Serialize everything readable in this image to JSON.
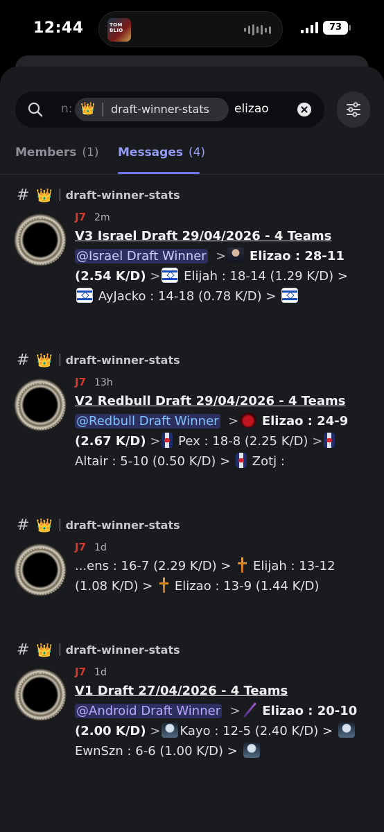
{
  "status_bar": {
    "time": "12:44",
    "island_art_text": "TOM BLIO",
    "battery": "73"
  },
  "search": {
    "prefix": "n:",
    "channel_chip": "draft-winner-stats",
    "query": "elizao"
  },
  "tabs": [
    {
      "label": "Members",
      "count": "(1)",
      "active": false
    },
    {
      "label": "Messages",
      "count": "(4)",
      "active": true
    }
  ],
  "colors": {
    "accent": "#949cf7",
    "author": "#d6392f",
    "mention_bg": "#3a3f73"
  },
  "results": [
    {
      "channel": "draft-winner-stats",
      "author": "J7",
      "timestamp": "2m",
      "title": "V3 Israel Draft 29/04/2026 - 4 Teams",
      "mention": "@Israel Draft Winner",
      "winner": "Elizao : 28-11 (2.54 K/D)",
      "rest1": "Elijah : 18-14 (1.29 K/D) >",
      "rest2": "AyJacko : 14-18 (0.78 K/D) >"
    },
    {
      "channel": "draft-winner-stats",
      "author": "J7",
      "timestamp": "13h",
      "title": "V2 Redbull Draft 29/04/2026 - 4 Teams",
      "mention": "@Redbull Draft Winner",
      "winner": "Elizao : 24-9 (2.67 K/D)",
      "rest1": "Pex : 18-8 (2.25 K/D)",
      "rest2": "Altair : 5-10 (0.50 K/D) >",
      "rest3": "Zotj :"
    },
    {
      "channel": "draft-winner-stats",
      "author": "J7",
      "timestamp": "1d",
      "line1": "...ens : 16-7 (2.29 K/D) >",
      "line2": "Elijah : 13-12",
      "line3": "(1.08 K/D) >",
      "line4": "Elizao : 13-9 (1.44 K/D)"
    },
    {
      "channel": "draft-winner-stats",
      "author": "J7",
      "timestamp": "1d",
      "title": "V1 Draft 27/04/2026 - 4 Teams",
      "mention": "@Android Draft Winner",
      "winner": "Elizao : 20-10 (2.00 K/D)",
      "rest1": "Kayo : 12-5 (2.40 K/D) >",
      "rest2": "EwnSzn : 6-6 (1.00 K/D) >"
    }
  ]
}
